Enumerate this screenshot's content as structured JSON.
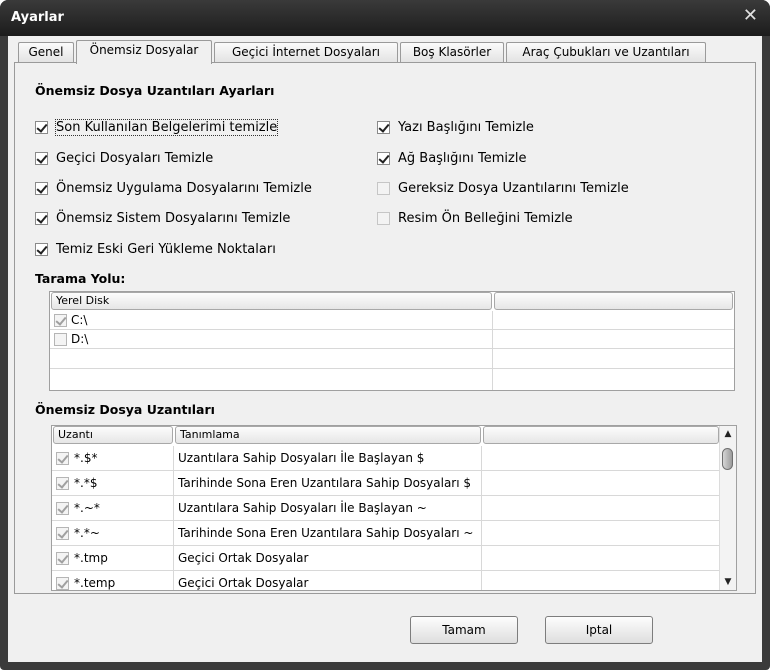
{
  "window": {
    "title": "Ayarlar",
    "close_glyph": "✕"
  },
  "tabs": [
    {
      "label": "Genel"
    },
    {
      "label": "Önemsiz Dosyalar"
    },
    {
      "label": "Geçici İnternet Dosyaları"
    },
    {
      "label": "Boş Klasörler"
    },
    {
      "label": "Araç Çubukları ve Uzantıları"
    }
  ],
  "settings": {
    "title": "Önemsiz Dosya Uzantıları Ayarları",
    "left": [
      {
        "label": "Son Kullanılan Belgelerimi temizle",
        "checked": true
      },
      {
        "label": "Geçici Dosyaları Temizle",
        "checked": true
      },
      {
        "label": "Önemsiz Uygulama Dosyalarını Temizle",
        "checked": true
      },
      {
        "label": "Önemsiz Sistem Dosyalarını Temizle",
        "checked": true
      },
      {
        "label": "Temiz Eski Geri Yükleme Noktaları",
        "checked": true
      }
    ],
    "right": [
      {
        "label": "Yazı Başlığını Temizle",
        "checked": true
      },
      {
        "label": "Ağ Başlığını Temizle",
        "checked": true
      },
      {
        "label": "Gereksiz Dosya Uzantılarını Temizle",
        "checked": false
      },
      {
        "label": "Resim Ön Belleğini Temizle",
        "checked": false
      }
    ]
  },
  "scan": {
    "title": "Tarama Yolu:",
    "columns": [
      "Yerel Disk",
      ""
    ],
    "rows": [
      {
        "path": "C:\\",
        "checked": true
      },
      {
        "path": "D:\\",
        "checked": false
      }
    ]
  },
  "extensions": {
    "title": "Önemsiz Dosya Uzantıları",
    "columns": [
      "Uzantı",
      "Tanımlama",
      ""
    ],
    "rows": [
      {
        "ext": "*.$*",
        "desc": "Uzantılara Sahip Dosyaları İle Başlayan $",
        "checked": true
      },
      {
        "ext": "*.*$",
        "desc": "Tarihinde Sona Eren Uzantılara Sahip Dosyaları $",
        "checked": true
      },
      {
        "ext": "*.~*",
        "desc": "Uzantılara Sahip Dosyaları İle Başlayan ~",
        "checked": true
      },
      {
        "ext": "*.*~",
        "desc": "Tarihinde Sona Eren Uzantılara Sahip Dosyaları ~",
        "checked": true
      },
      {
        "ext": "*.tmp",
        "desc": "Geçici Ortak Dosyalar",
        "checked": true
      },
      {
        "ext": "*.temp",
        "desc": "Geçici Ortak Dosyalar",
        "checked": true
      }
    ],
    "scroll_up": "▲",
    "scroll_down": "▼"
  },
  "buttons": {
    "ok": "Tamam",
    "cancel": "Iptal"
  }
}
